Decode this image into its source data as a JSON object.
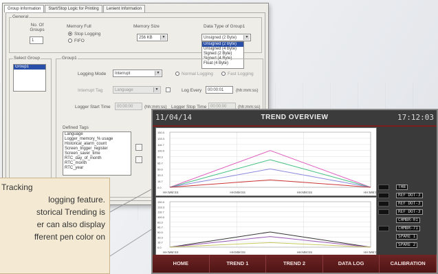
{
  "config": {
    "tabs": [
      "Group Information",
      "Start/Stop Logic for Printing",
      "Lenient Information"
    ],
    "general_title": "General",
    "no_of_groups_label": "No. Of Groups",
    "no_of_groups_value": "1",
    "memory_full_label": "Memory Full",
    "memory_full_options": [
      "Stop Logging",
      "FIFO"
    ],
    "memory_size_label": "Memory Size",
    "memory_size_value": "256 KB",
    "data_type_label": "Data Type of Group1",
    "data_type_value": "Unsigned (2 Byte)",
    "data_type_options": [
      "Unsigned (2 Byte)",
      "Unsigned (4 Byte)",
      "Signed (2 Byte)",
      "Signed (4 Byte)",
      "Float (4 Byte)"
    ],
    "select_group_label": "Select Group",
    "select_group_items": [
      "Group1"
    ],
    "group_label": "Group1",
    "logging_mode_label": "Logging Mode",
    "logging_mode_value": "Interrupt",
    "normal_logging": "Normal Logging",
    "fast_logging": "Fast Logging",
    "interrupt_tag_label": "Interrupt Tag",
    "interrupt_tag_value": "Language",
    "log_every_label": "Log Every",
    "log_every_value": "00:00:01",
    "log_every_unit": "(hh:mm:ss)",
    "logger_start_label": "Logger Start Time",
    "logger_start_value": "00:00:00",
    "logger_start_unit": "(hh:mm:ss)",
    "logger_stop_label": "Logger Stop Time",
    "logger_stop_value": "00:00:00",
    "logger_stop_unit": "(hh:mm:ss)",
    "defined_tags_label": "Defined Tags",
    "defined_tags": [
      "Language",
      "Logger_memory_% usage",
      "Historical_alarm_count",
      "Screen_trigger_register",
      "Screen_saver_time",
      "RTC_day_of_month",
      "RTC_month",
      "RTC_year"
    ]
  },
  "trend": {
    "date": "11/04/14",
    "title": "TREND OVERVIEW",
    "time": "17:12:03",
    "legend_top": [
      {
        "label": "THB",
        "color": "#c8c8c8"
      },
      {
        "label": "REF DOT-3",
        "color": "#e0e0e0"
      },
      {
        "label": "REF DOT-3",
        "color": "#e0e0e0"
      },
      {
        "label": "REF DOT-3",
        "color": "#e0e0e0"
      }
    ],
    "legend_bottom": [
      {
        "label": "CHMBR-01",
        "color": "#e0e0e0"
      },
      {
        "label": "CHMBR-71",
        "color": "#e0e0e0"
      },
      {
        "label": "SPARE 1",
        "color": "#e0e0e0"
      },
      {
        "label": "SPARE 2",
        "color": "#e0e0e0"
      }
    ],
    "nav": [
      "HOME",
      "TREND 1",
      "TREND 2",
      "DATA LOG",
      "CALIBRATION"
    ]
  },
  "callout": {
    "lines": [
      "Tracking",
      "logging feature.",
      "storical Trending is",
      "er can also display",
      "fferent pen color on"
    ]
  },
  "chart_data": [
    {
      "type": "line",
      "x": [
        0,
        1,
        2,
        3
      ],
      "series": [
        {
          "color": "#e060c0",
          "values": [
            0.0,
            100.0,
            0.0
          ]
        },
        {
          "color": "#40c080",
          "values": [
            0.0,
            75.0,
            0.0
          ]
        },
        {
          "color": "#8888dd",
          "values": [
            0.0,
            50.0,
            0.0
          ]
        },
        {
          "color": "#cc3333",
          "values": [
            0.0,
            20.0,
            0.0
          ]
        }
      ],
      "yticks": [
        "150.0",
        "133.3",
        "116.7",
        "100.0",
        "83.3",
        "66.7",
        "50.0",
        "33.3",
        "16.7",
        "0.0"
      ],
      "xticks": [
        "HH:MM:SS",
        "HH:MM:SS",
        "HH:MM:SS",
        "HH:MM:SS"
      ]
    },
    {
      "type": "line",
      "series": [
        {
          "color": "#333333",
          "values": [
            0.0,
            50.0,
            0.0
          ]
        },
        {
          "color": "#9b59b6",
          "values": [
            0.0,
            35.0,
            0.0
          ]
        },
        {
          "color": "#c8c860",
          "values": [
            0.0,
            15.0,
            0.0
          ]
        }
      ],
      "yticks": [
        "150.0",
        "133.3",
        "116.7",
        "100.0",
        "83.3",
        "66.7",
        "50.0",
        "33.3",
        "16.7",
        "0.0"
      ],
      "xticks": [
        "HH:MM:SS",
        "HH:MM:SS",
        "HH:MM:SS",
        "HH:MM:SS"
      ]
    }
  ]
}
